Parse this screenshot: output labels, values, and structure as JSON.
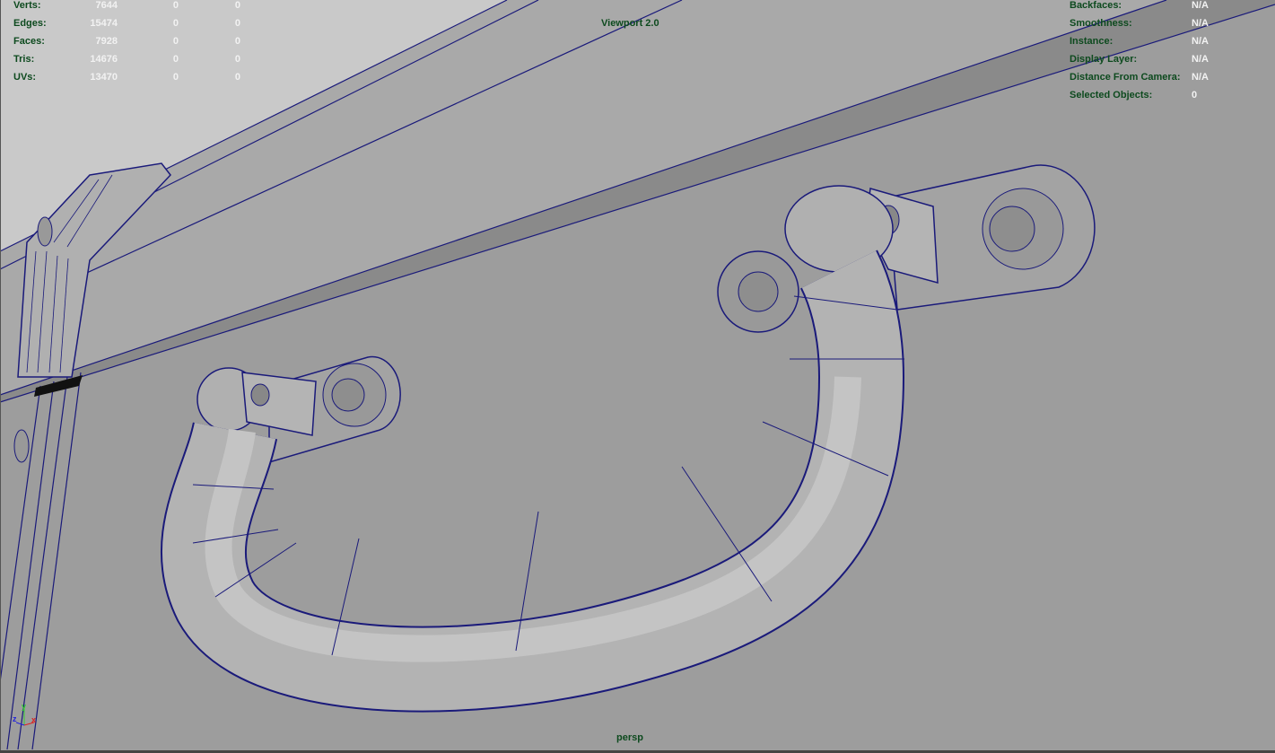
{
  "viewport": {
    "title": "Viewport 2.0",
    "camera": "persp",
    "wire_color": "#1a1a7a",
    "surface_color": "#9d9d9d"
  },
  "stats": [
    {
      "label": "Verts:",
      "values": [
        "7644",
        "0",
        "0"
      ]
    },
    {
      "label": "Edges:",
      "values": [
        "15474",
        "0",
        "0"
      ]
    },
    {
      "label": "Faces:",
      "values": [
        "7928",
        "0",
        "0"
      ]
    },
    {
      "label": "Tris:",
      "values": [
        "14676",
        "0",
        "0"
      ]
    },
    {
      "label": "UVs:",
      "values": [
        "13470",
        "0",
        "0"
      ]
    }
  ],
  "info": [
    {
      "label": "Backfaces:",
      "value": "N/A"
    },
    {
      "label": "Smoothness:",
      "value": "N/A"
    },
    {
      "label": "Instance:",
      "value": "N/A"
    },
    {
      "label": "Display Layer:",
      "value": "N/A"
    },
    {
      "label": "Distance From Camera:",
      "value": "N/A"
    },
    {
      "label": "Selected Objects:",
      "value": "0"
    }
  ],
  "axis": {
    "x": "x",
    "y": "y",
    "z": "z"
  }
}
